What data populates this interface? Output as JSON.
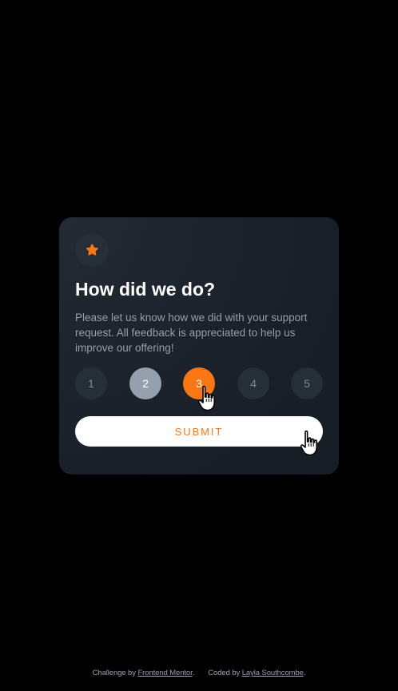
{
  "card": {
    "title": "How did we do?",
    "description": "Please let us know how we did with your support request. All feedback is appreciated to help us improve our offering!",
    "ratings": [
      "1",
      "2",
      "3",
      "4",
      "5"
    ],
    "hovered_rating": "2",
    "selected_rating": "3",
    "submit_label": "SUBMIT"
  },
  "footer": {
    "challenge_prefix": "Challenge by",
    "challenge_link": "Frontend Mentor",
    "challenge_suffix": ".",
    "coded_prefix": "Coded by",
    "coded_link": "Layla Southcombe",
    "coded_suffix": "."
  },
  "colors": {
    "background": "#000000",
    "card": "#181e27",
    "accent": "#fc7614",
    "hover_grey": "#969fad",
    "muted_text": "#959eac"
  },
  "icons": {
    "badge": "star-icon",
    "cursor": "hand-pointer-icon"
  }
}
